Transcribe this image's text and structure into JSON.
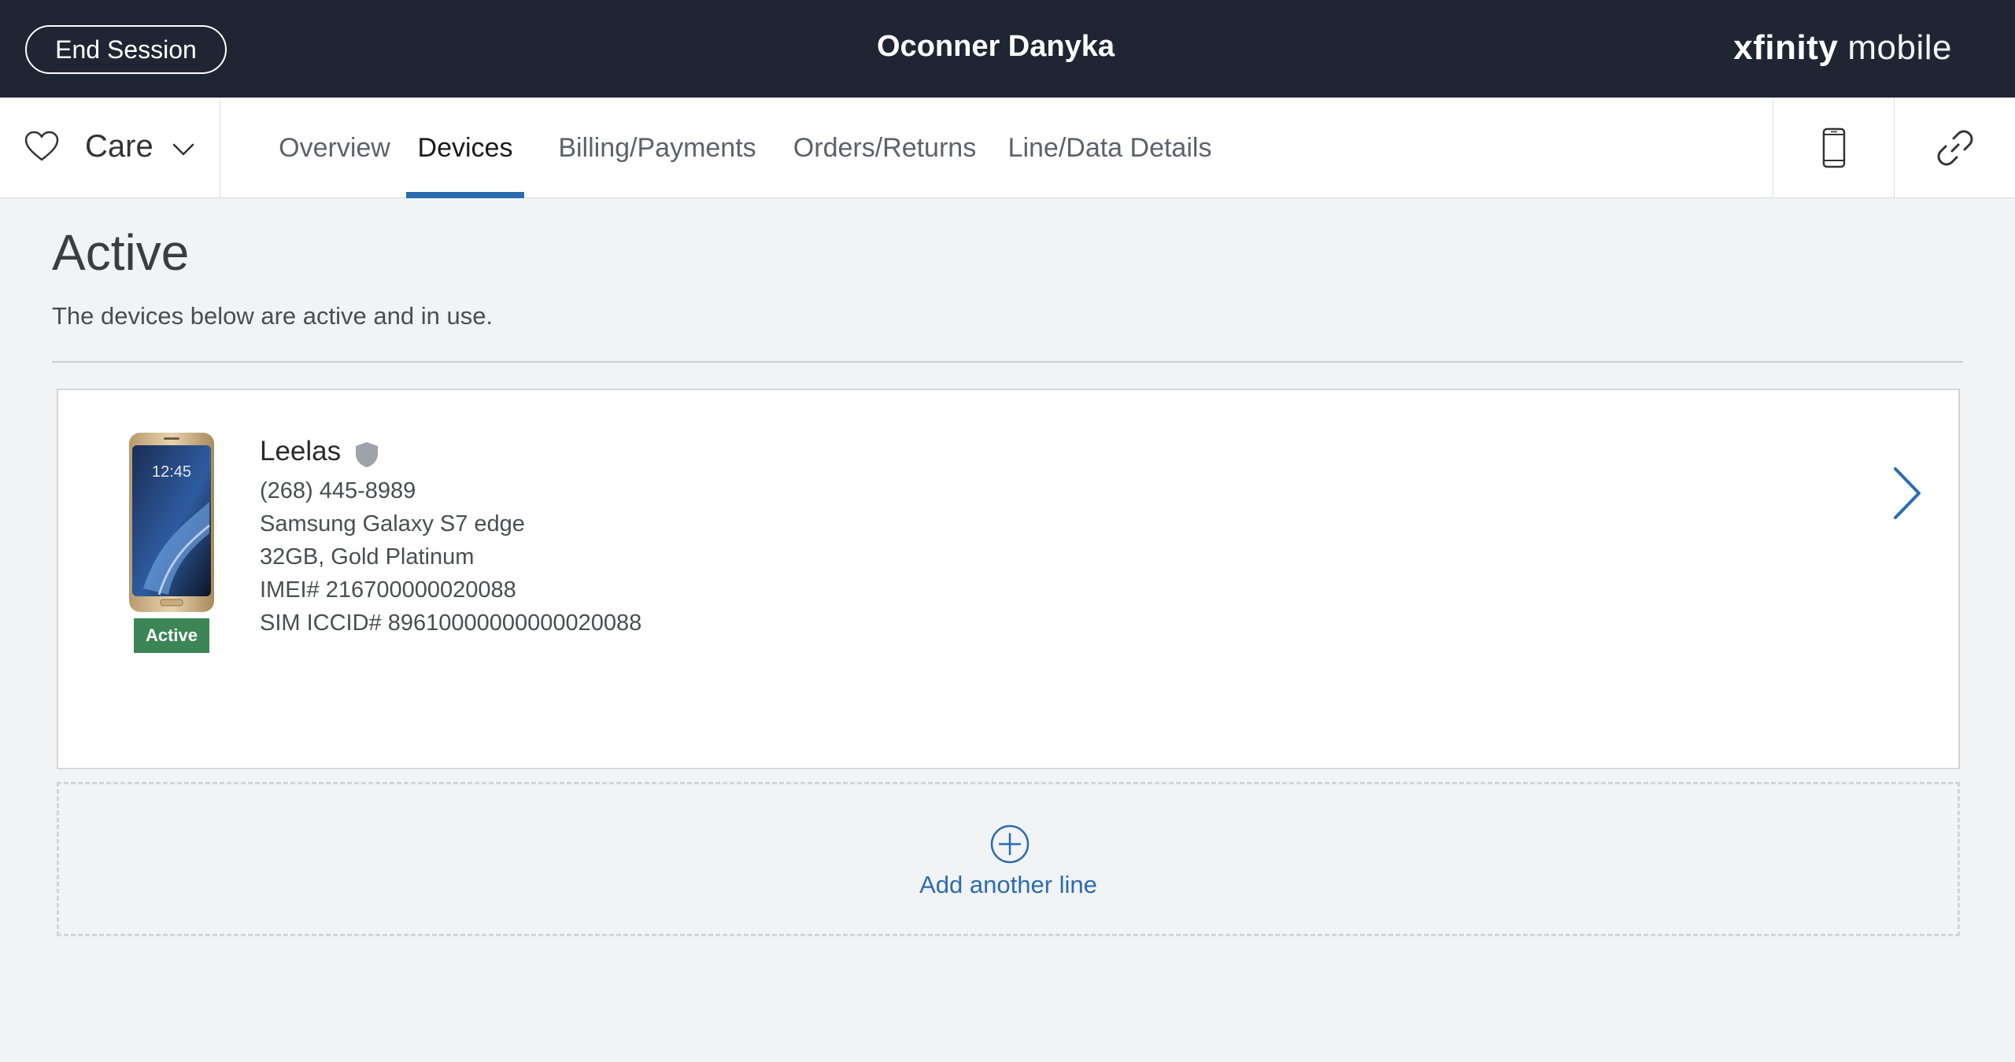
{
  "header": {
    "end_session_label": "End Session",
    "customer_name": "Oconner Danyka",
    "brand_part1": "xfinity",
    "brand_part2": "mobile"
  },
  "nav": {
    "care_label": "Care",
    "tabs": [
      {
        "label": "Overview",
        "active": false
      },
      {
        "label": "Devices",
        "active": true
      },
      {
        "label": "Billing/Payments",
        "active": false
      },
      {
        "label": "Orders/Returns",
        "active": false
      },
      {
        "label": "Line/Data Details",
        "active": false
      }
    ],
    "icons": [
      "phone-icon",
      "link-icon"
    ]
  },
  "main": {
    "title": "Active",
    "subtitle": "The devices below are active and in use.",
    "devices": [
      {
        "name": "Leelas",
        "phone": "(268) 445-8989",
        "model": "Samsung Galaxy S7 edge",
        "storage_color": "32GB, Gold Platinum",
        "imei": "IMEI# 216700000020088",
        "sim": "SIM ICCID# 89610000000000020088",
        "status": "Active",
        "screen_time": "12:45"
      }
    ],
    "add_line_label": "Add another line"
  },
  "colors": {
    "header_bg": "#1f2533",
    "accent": "#2b6cb0",
    "active_badge": "#3b8654",
    "page_bg": "#f2f3f5"
  }
}
